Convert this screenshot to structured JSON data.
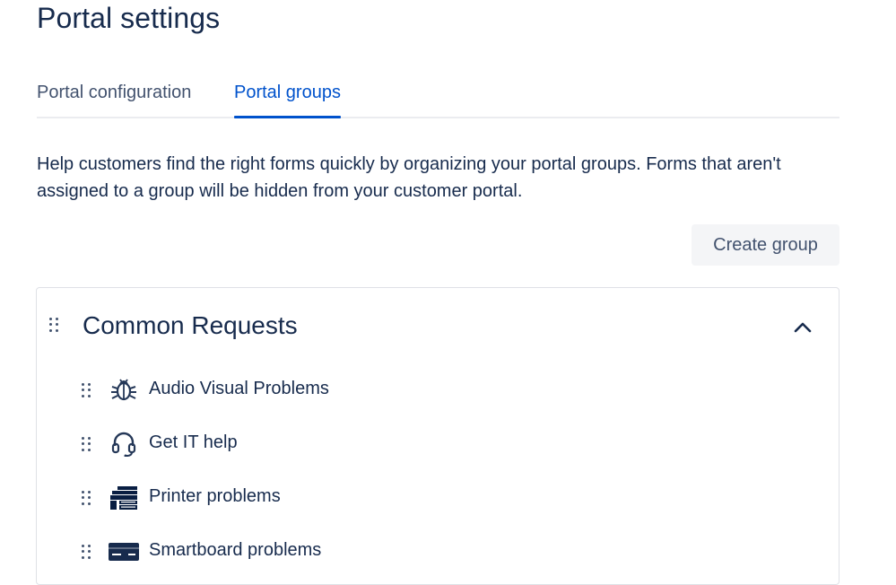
{
  "page": {
    "title": "Portal settings"
  },
  "tabs": [
    {
      "label": "Portal configuration",
      "selected": false
    },
    {
      "label": "Portal groups",
      "selected": true
    }
  ],
  "description": "Help customers find the right forms quickly by organizing your portal groups. Forms that aren't assigned to a group will be hidden from your customer portal.",
  "actions": {
    "create_group_label": "Create group"
  },
  "group": {
    "title": "Common Requests",
    "expanded": true,
    "items": [
      {
        "label": "Audio Visual Problems",
        "icon": "bug-icon"
      },
      {
        "label": "Get IT help",
        "icon": "headset-icon"
      },
      {
        "label": "Printer problems",
        "icon": "printer-icon"
      },
      {
        "label": "Smartboard problems",
        "icon": "card-icon"
      }
    ]
  },
  "colors": {
    "text": "#172b4d",
    "accent": "#0052cc",
    "muted": "#42526e",
    "button_bg": "#f4f5f7"
  }
}
